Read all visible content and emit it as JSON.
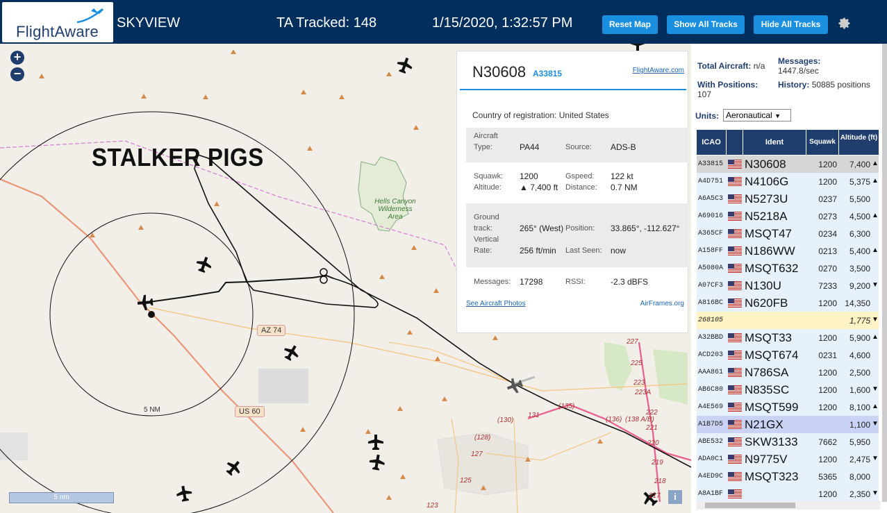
{
  "header": {
    "logo": "FlightAware",
    "app_name": "SKYVIEW",
    "tracked": "TA Tracked: 148",
    "datetime": "1/15/2020, 1:32:57 PM",
    "buttons": [
      "Reset Map",
      "Show All Tracks",
      "Hide All Tracks"
    ],
    "settings_icon": "gear-icon",
    "colors": {
      "bar": "#002f5d",
      "button": "#1a8fe0"
    }
  },
  "map": {
    "overlay_text": "STALKER PIGS",
    "wilderness": "Hells Canyon Wilderness Area",
    "ring_label": "5 NM",
    "scale_label": "5 nm",
    "shields": [
      "AZ 74",
      "US 60"
    ],
    "route_labels": [
      "(135)",
      "(136)",
      "(138 A/B)",
      "(130)",
      "(128)",
      "127",
      "131",
      "125",
      "123",
      "221",
      "220",
      "219",
      "218",
      "217",
      "227",
      "225",
      "223",
      "223A",
      "222"
    ],
    "zoom_in": "+",
    "zoom_out": "−",
    "info": "i"
  },
  "popup": {
    "callsign": "N30608",
    "hex": "A33815",
    "link": "FlightAware.com",
    "country_label": "Country of registration:",
    "country": "United States",
    "aircraft_type_label": "Aircraft Type:",
    "aircraft_type": "PA44",
    "source_label": "Source:",
    "source": "ADS-B",
    "squawk_label": "Squawk:",
    "squawk": "1200",
    "gspeed_label": "Gspeed:",
    "gspeed": "122 kt",
    "altitude_label": "Altitude:",
    "altitude": "▲ 7,400 ft",
    "distance_label": "Distance:",
    "distance": "0.7 NM",
    "ground_track_label": "Ground track:",
    "ground_track": "265° (West)",
    "position_label": "Position:",
    "position": "33.865°, -112.627°",
    "vertical_rate_label": "Vertical Rate:",
    "vertical_rate": "256 ft/min",
    "last_seen_label": "Last Seen:",
    "last_seen": "now",
    "messages_label": "Messages:",
    "messages": "17298",
    "rssi_label": "RSSI:",
    "rssi": "-2.3 dBFS",
    "photos_link": "See Aircraft Photos",
    "airframes_link": "AirFrames.org"
  },
  "stats": {
    "total_label": "Total Aircraft:",
    "total": "n/a",
    "messages_label": "Messages:",
    "messages_rate": "1447.8/sec",
    "positions_label": "With Positions:",
    "positions": "107",
    "history_label": "History:",
    "history": "50885 positions",
    "units_label": "Units:",
    "units": "Aeronautical"
  },
  "table": {
    "headers": [
      "ICAO",
      "",
      "Ident",
      "Squawk",
      "Altitude (ft)"
    ],
    "rows": [
      {
        "icao": "A33815",
        "ident": "N30608",
        "squawk": "1200",
        "alt": "7,400",
        "trend": "▲",
        "style": "sel"
      },
      {
        "icao": "A4D751",
        "ident": "N4106G",
        "squawk": "1200",
        "alt": "5,375",
        "trend": "▲",
        "style": ""
      },
      {
        "icao": "A6A5C3",
        "ident": "N5273U",
        "squawk": "0237",
        "alt": "5,500",
        "trend": "",
        "style": ""
      },
      {
        "icao": "A69016",
        "ident": "N5218A",
        "squawk": "0273",
        "alt": "4,500",
        "trend": "▲",
        "style": ""
      },
      {
        "icao": "A365CF",
        "ident": "MSQT47",
        "squawk": "0234",
        "alt": "6,300",
        "trend": "",
        "style": ""
      },
      {
        "icao": "A158FF",
        "ident": "N186WW",
        "squawk": "0213",
        "alt": "5,400",
        "trend": "▲",
        "style": ""
      },
      {
        "icao": "A5080A",
        "ident": "MSQT632",
        "squawk": "0270",
        "alt": "3,500",
        "trend": "",
        "style": ""
      },
      {
        "icao": "A07CF3",
        "ident": "N130U",
        "squawk": "7233",
        "alt": "9,200",
        "trend": "▼",
        "style": ""
      },
      {
        "icao": "A816BC",
        "ident": "N620FB",
        "squawk": "1200",
        "alt": "14,350",
        "trend": "",
        "style": ""
      },
      {
        "icao": "268105",
        "ident": "",
        "squawk": "",
        "alt": "1,775",
        "trend": "▼",
        "style": "yellow"
      },
      {
        "icao": "A32BBD",
        "ident": "MSQT33",
        "squawk": "1200",
        "alt": "5,900",
        "trend": "▲",
        "style": ""
      },
      {
        "icao": "ACD203",
        "ident": "MSQT674",
        "squawk": "0231",
        "alt": "4,600",
        "trend": "",
        "style": ""
      },
      {
        "icao": "AAA861",
        "ident": "N786SA",
        "squawk": "1200",
        "alt": "2,500",
        "trend": "",
        "style": ""
      },
      {
        "icao": "AB6C80",
        "ident": "N835SC",
        "squawk": "1200",
        "alt": "1,600",
        "trend": "▼",
        "style": ""
      },
      {
        "icao": "A4E569",
        "ident": "MSQT599",
        "squawk": "1200",
        "alt": "8,100",
        "trend": "▲",
        "style": ""
      },
      {
        "icao": "A1B7D5",
        "ident": "N21GX",
        "squawk": "",
        "alt": "1,100",
        "trend": "▼",
        "style": "purple"
      },
      {
        "icao": "ABE532",
        "ident": "SKW3133",
        "squawk": "7662",
        "alt": "5,950",
        "trend": "",
        "style": ""
      },
      {
        "icao": "ADA0C1",
        "ident": "N9775V",
        "squawk": "1200",
        "alt": "2,475",
        "trend": "▼",
        "style": ""
      },
      {
        "icao": "A4ED9C",
        "ident": "MSQT323",
        "squawk": "5365",
        "alt": "8,000",
        "trend": "",
        "style": ""
      },
      {
        "icao": "A8A1BF",
        "ident": "",
        "squawk": "1200",
        "alt": "2,350",
        "trend": "▼",
        "style": ""
      }
    ]
  }
}
